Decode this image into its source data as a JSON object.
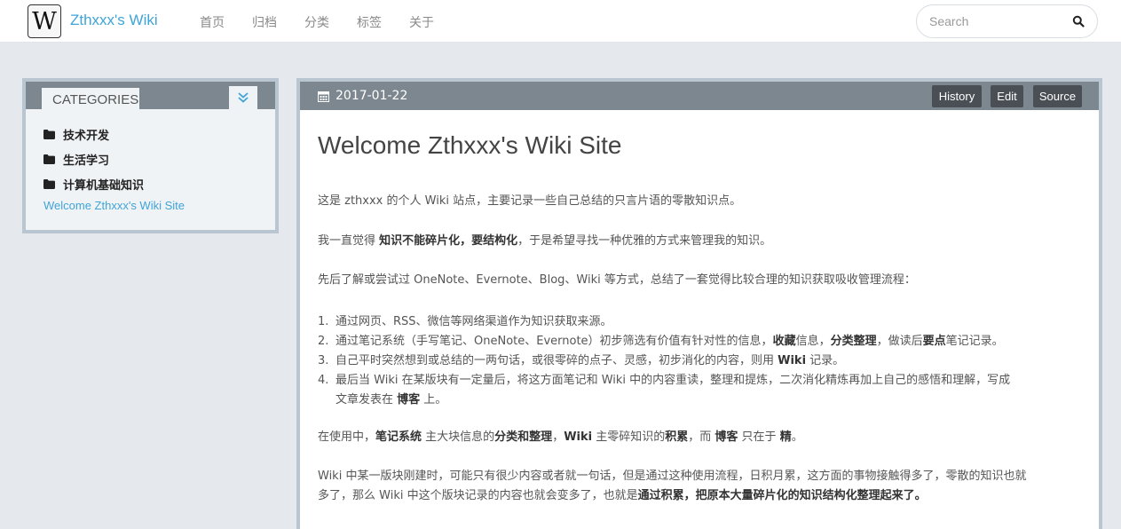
{
  "header": {
    "logo_letter": "W",
    "brand": "Zthxxx's Wiki",
    "nav": [
      "首页",
      "归档",
      "分类",
      "标签",
      "关于"
    ],
    "search_placeholder": "Search",
    "search_icon": "search-icon"
  },
  "sidebar": {
    "title": "CATEGORIES",
    "collapse_icon": "chevron-double-down-icon",
    "categories": [
      "技术开发",
      "生活学习",
      "计算机基础知识"
    ],
    "folder_icon": "folder-icon",
    "link": "Welcome Zthxxx's Wiki Site"
  },
  "article": {
    "date": "2017-01-22",
    "calendar_icon": "calendar-icon",
    "buttons": {
      "history": "History",
      "edit": "Edit",
      "source": "Source"
    },
    "title": "Welcome Zthxxx's Wiki Site",
    "p1": "这是 zthxxx 的个人 Wiki 站点，主要记录一些自己总结的只言片语的零散知识点。",
    "p2": {
      "a": "我一直觉得 ",
      "b": "知识不能碎片化，要结构化",
      "c": "，于是希望寻找一种优雅的方式来管理我的知识。"
    },
    "p3": "先后了解或尝试过 OneNote、Evernote、Blog、Wiki 等方式，总结了一套觉得比较合理的知识获取吸收管理流程：",
    "list": [
      {
        "num": "1.",
        "a": "通过网页、RSS、微信等网络渠道作为知识获取来源。"
      },
      {
        "num": "2.",
        "a": "通过笔记系统（手写笔记、OneNote、Evernote）初步筛选有价值有针对性的信息，",
        "b": "收藏",
        "c": "信息，",
        "d": "分类整理",
        "e": "，做读后",
        "f": "要点",
        "g": "笔记记录。"
      },
      {
        "num": "3.",
        "a": "自己平时突然想到或总结的一两句话，或很零碎的点子、灵感，初步消化的内容，则用 ",
        "b": "Wiki",
        "c": " 记录。"
      },
      {
        "num": "4.",
        "a": "最后当 Wiki 在某版块有一定量后，将这方面笔记和 Wiki 中的内容重读，整理和提炼，二次消化精炼再加上自己的感悟和理解，写成",
        "a2": "文章发表在 ",
        "b": "博客",
        "c": " 上。"
      }
    ],
    "p4": {
      "a": "在使用中，",
      "b": "笔记系统",
      "c": " 主大块信息的",
      "d": "分类和整理",
      "e": "，",
      "f": "Wiki",
      "g": " 主零碎知识的",
      "h": "积累",
      "i": "，而 ",
      "j": "博客",
      "k": " 只在于 ",
      "l": "精",
      "m": "。"
    },
    "p5": {
      "a": "Wiki 中某一版块刚建时，可能只有很少内容或者就一句话，但是通过这种使用流程，日积月累，这方面的事物接触得多了，零散的知识也就",
      "b": "多了，那么 Wiki 中这个版块记录的内容也就会变多了，也就是",
      "c": "通过积累，把原本大量碎片化的知识结构化整理起来了。"
    }
  }
}
